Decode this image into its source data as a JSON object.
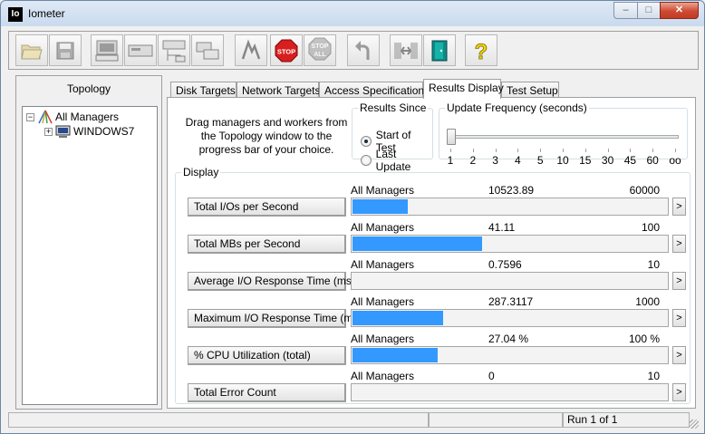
{
  "window": {
    "app_icon": "Io",
    "title": "Iometer",
    "min": "–",
    "max": "□",
    "close": "✕"
  },
  "toolbar": {
    "buttons": [
      {
        "name": "open-config-icon"
      },
      {
        "name": "save-config-icon"
      },
      {
        "name": "new-disk-worker-icon"
      },
      {
        "name": "new-network-worker-icon"
      },
      {
        "name": "new-manager-icon"
      },
      {
        "name": "duplicate-worker-icon"
      },
      {
        "name": "start-tests-icon"
      },
      {
        "name": "stop-icon",
        "text": "STOP"
      },
      {
        "name": "stop-all-icon",
        "text1": "STOP",
        "text2": "ALL"
      },
      {
        "name": "reset-workers-icon"
      },
      {
        "name": "exit-manager-icon"
      },
      {
        "name": "exit-icon"
      },
      {
        "name": "about-icon",
        "text": "?"
      }
    ]
  },
  "topology": {
    "title": "Topology",
    "root_label": "All Managers",
    "manager_label": "WINDOWS7",
    "collapse": "−",
    "expand": "+"
  },
  "tabs": [
    "Disk Targets",
    "Network Targets",
    "Access Specifications",
    "Results Display",
    "Test Setup"
  ],
  "active_tab": "Results Display",
  "results": {
    "instructions": "Drag managers and workers from the Topology window to the progress bar of your choice.",
    "results_since": {
      "legend": "Results Since",
      "options": [
        "Start of Test",
        "Last Update"
      ],
      "selected": "Start of Test"
    },
    "update_frequency": {
      "legend": "Update Frequency (seconds)",
      "ticks": [
        "1",
        "2",
        "3",
        "4",
        "5",
        "10",
        "15",
        "30",
        "45",
        "60",
        "oo"
      ],
      "selected": "1"
    },
    "display": {
      "legend": "Display",
      "more": ">",
      "metrics": [
        {
          "label": "Total I/Os per Second",
          "scope": "All Managers",
          "value": "10523.89",
          "max": "60000",
          "fraction": 0.1754
        },
        {
          "label": "Total MBs per Second",
          "scope": "All Managers",
          "value": "41.11",
          "max": "100",
          "fraction": 0.4111
        },
        {
          "label": "Average I/O Response Time (ms)",
          "scope": "All Managers",
          "value": "0.7596",
          "max": "10",
          "fraction": 0.0
        },
        {
          "label": "Maximum I/O Response Time (ms)",
          "scope": "All Managers",
          "value": "287.3117",
          "max": "1000",
          "fraction": 0.2873
        },
        {
          "label": "% CPU Utilization (total)",
          "scope": "All Managers",
          "value": "27.04 %",
          "max": "100 %",
          "fraction": 0.2704
        },
        {
          "label": "Total Error Count",
          "scope": "All Managers",
          "value": "0",
          "max": "10",
          "fraction": 0.0
        }
      ]
    }
  },
  "status": {
    "pane1": "",
    "pane2": "",
    "run": "Run 1 of 1"
  },
  "colors": {
    "bar": "#3399ff",
    "accent_close": "#c13c23"
  }
}
